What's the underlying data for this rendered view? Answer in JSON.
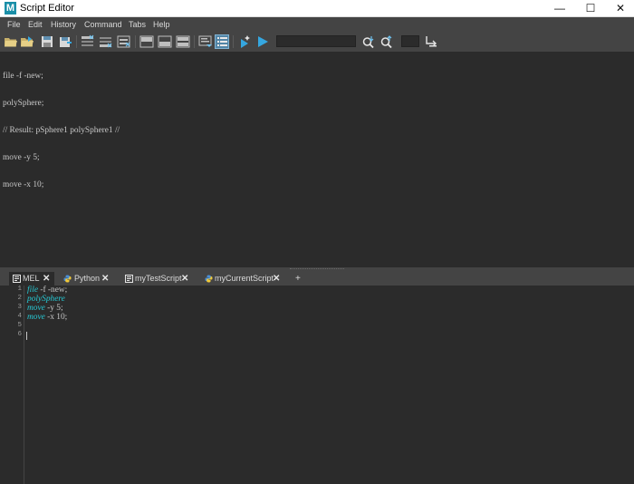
{
  "window": {
    "title": "Script Editor",
    "app_icon_letter": "M",
    "controls": {
      "minimize": "—",
      "maximize": "☐",
      "close": "✕"
    }
  },
  "menu": [
    "File",
    "Edit",
    "History",
    "Command",
    "Tabs",
    "Help"
  ],
  "toolbar": {
    "icons": [
      "open-script-icon",
      "source-script-icon",
      "save-script-icon",
      "save-to-shelf-icon",
      "clear-history-icon",
      "clear-input-icon",
      "clear-all-icon",
      "show-history-icon",
      "show-input-icon",
      "show-both-icon",
      "echo-all-commands-icon",
      "show-line-numbers-icon",
      "execute-selected-icon",
      "execute-all-icon",
      "search-down-icon",
      "search-up-icon",
      "goto-line-icon"
    ],
    "search_value": "",
    "line_value": ""
  },
  "history": {
    "lines": [
      "file -f -new;",
      "polySphere;",
      "// Result: pSphere1 polySphere1 //",
      "move -y 5;",
      "move -x 10;"
    ]
  },
  "tabs": [
    {
      "label": "MEL",
      "icon": "mel-icon",
      "active": true,
      "close": "✕"
    },
    {
      "label": "Python",
      "icon": "python-icon",
      "active": false,
      "close": "✕"
    },
    {
      "label": "myTestScript",
      "icon": "mel-icon",
      "active": false,
      "close": "✕"
    },
    {
      "label": "myCurrentScript",
      "icon": "python-icon",
      "active": false,
      "close": "✕"
    }
  ],
  "add_tab": "+",
  "editor": {
    "line_numbers": [
      "1",
      "2",
      "3",
      "4",
      "5",
      "6"
    ],
    "lines": [
      {
        "kw": "file",
        "rest": " -f -new;"
      },
      {
        "kw": "polySphere",
        "rest": ""
      },
      {
        "kw": "move",
        "rest": " -y 5;"
      },
      {
        "kw": "move",
        "rest": " -x 10;"
      },
      {
        "kw": "",
        "rest": ""
      },
      {
        "kw": "",
        "rest": ""
      }
    ]
  },
  "colors": {
    "background": "#444444",
    "pane": "#2b2b2b",
    "keyword": "#27c9d4",
    "text": "#c8c8c8",
    "active_toggle": "#5285a6"
  }
}
